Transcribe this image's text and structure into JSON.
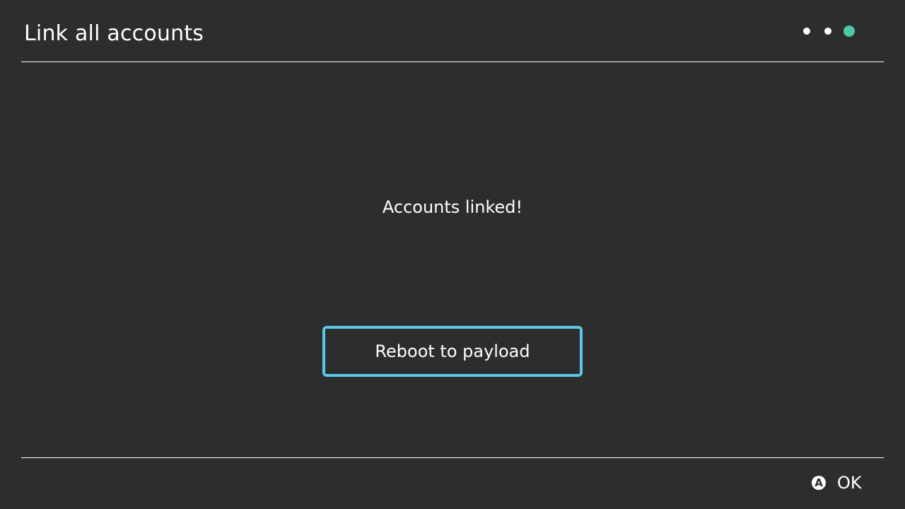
{
  "header": {
    "title": "Link all accounts",
    "pager": {
      "total_pages": 3,
      "current_page": 3,
      "active_color": "#4fc7a8"
    }
  },
  "main": {
    "status_message": "Accounts linked!",
    "reboot_button_label": "Reboot to payload",
    "button_focus_color": "#5ac8e8"
  },
  "footer": {
    "action_icon": "a-button-icon",
    "action_icon_glyph": "A",
    "action_label": "OK"
  }
}
